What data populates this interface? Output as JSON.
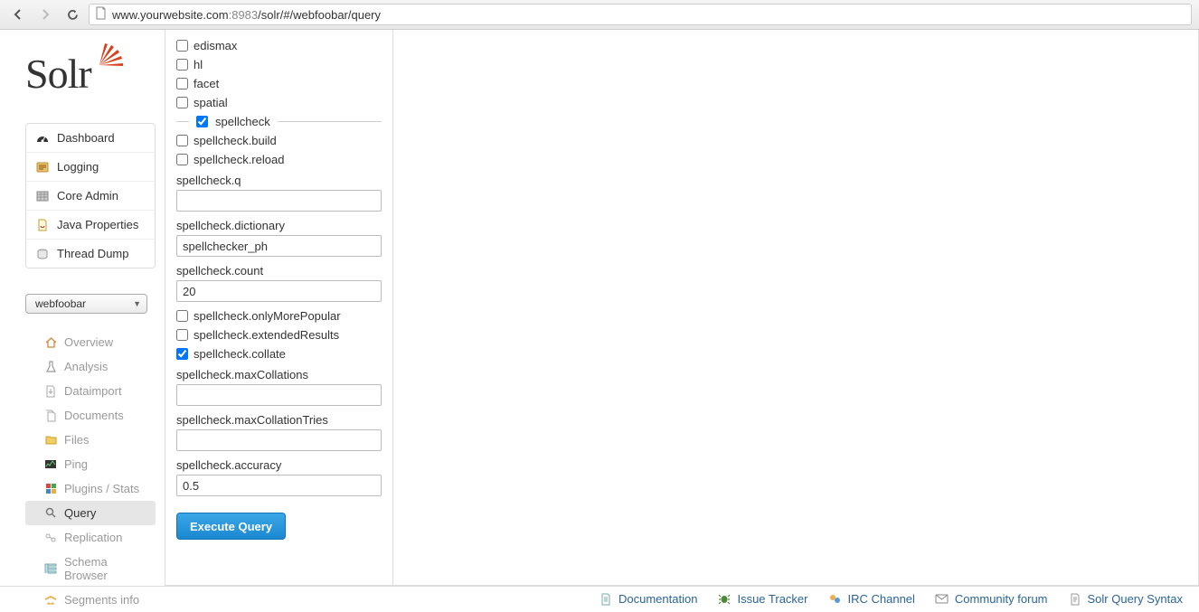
{
  "browser": {
    "url_host": "www.yourwebsite.com",
    "url_port": ":8983",
    "url_path": "/solr/#/webfoobar/query"
  },
  "logo": {
    "text": "Solr"
  },
  "nav": {
    "dashboard": "Dashboard",
    "logging": "Logging",
    "core_admin": "Core Admin",
    "java_props": "Java Properties",
    "thread_dump": "Thread Dump"
  },
  "core_selector": {
    "value": "webfoobar"
  },
  "subnav": {
    "overview": "Overview",
    "analysis": "Analysis",
    "dataimport": "Dataimport",
    "documents": "Documents",
    "files": "Files",
    "ping": "Ping",
    "plugins": "Plugins / Stats",
    "query": "Query",
    "replication": "Replication",
    "schema": "Schema Browser",
    "segments": "Segments info"
  },
  "form": {
    "edismax": "edismax",
    "hl": "hl",
    "facet": "facet",
    "spatial": "spatial",
    "spellcheck": "spellcheck",
    "sc_build": "spellcheck.build",
    "sc_reload": "spellcheck.reload",
    "sc_q_label": "spellcheck.q",
    "sc_q_value": "",
    "sc_dict_label": "spellcheck.dictionary",
    "sc_dict_value": "spellchecker_ph",
    "sc_count_label": "spellcheck.count",
    "sc_count_value": "20",
    "sc_onlymore": "spellcheck.onlyMorePopular",
    "sc_extended": "spellcheck.extendedResults",
    "sc_collate": "spellcheck.collate",
    "sc_maxcoll_label": "spellcheck.maxCollations",
    "sc_maxcoll_value": "",
    "sc_maxcolltries_label": "spellcheck.maxCollationTries",
    "sc_maxcolltries_value": "",
    "sc_accuracy_label": "spellcheck.accuracy",
    "sc_accuracy_value": "0.5",
    "execute": "Execute Query"
  },
  "footer": {
    "docs": "Documentation",
    "issues": "Issue Tracker",
    "irc": "IRC Channel",
    "forum": "Community forum",
    "syntax": "Solr Query Syntax"
  }
}
